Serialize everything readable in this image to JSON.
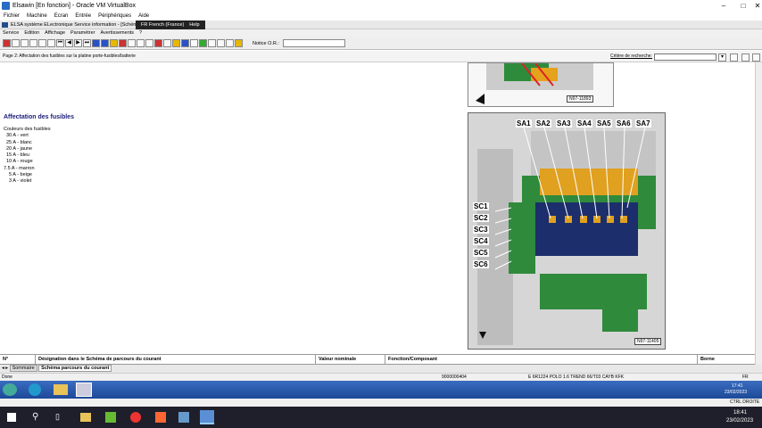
{
  "window": {
    "title": "Elsawin [En fonction] - Oracle VM VirtualBox"
  },
  "vbox_menu": [
    "Fichier",
    "Machine",
    "Ecran",
    "Entrée",
    "Périphériques",
    "Aide"
  ],
  "guest": {
    "title": "ELSA système ELectronique Service information - [Schéma",
    "lang_popup": {
      "lang": "FR French (France)",
      "help": "Help"
    }
  },
  "app_menu": [
    "Service",
    "Edition",
    "Affichage",
    "Paramétrer",
    "Avertissements",
    "?"
  ],
  "toolbar": {
    "notice_label": "Notice O.R.:"
  },
  "page_bar": {
    "title": "Page 2: Affectation des fusibles sur la platine porte-fusibles/batterie",
    "criteria_label": "Critère de recherche:"
  },
  "doc": {
    "heading": "Affectation des fusibles",
    "fuse_colors": [
      "Couleurs des fusibles",
      "30 A - vert",
      "25 A - blanc",
      "20 A - jaune",
      "15 A - bleu",
      "10 A - rouge",
      "7.5 A - marron",
      "5 A - beige",
      "3 A - violet"
    ]
  },
  "figure_top": {
    "ref": "N97-11893"
  },
  "figure_main": {
    "ref": "N97-11405",
    "top_labels": [
      "SA1",
      "SA2",
      "SA3",
      "SA4",
      "SA5",
      "SA6",
      "SA7"
    ],
    "side_labels": [
      "SC1",
      "SC2",
      "SC3",
      "SC4",
      "SC5",
      "SC6"
    ]
  },
  "table": {
    "headers": [
      "N°",
      "Désignation dans le Schéma de parcours du courant",
      "Valeur nominale",
      "Fonction/Composant",
      "Borne"
    ]
  },
  "tabs": {
    "summary": "Sommaire",
    "schema": "Schéma parcours du courant"
  },
  "status": {
    "left": "Done",
    "code": "9000000404",
    "vehicle": "E 6R1224  POLO 1.6 TREND 66/T03  CAYB  KFK",
    "lang": "FR"
  },
  "guest_clock": {
    "time": "17:41",
    "date": "23/02/2023"
  },
  "vbox_status": {
    "ctrl": "CTRL DROITE"
  },
  "host_clock": {
    "time": "18:41",
    "date": "23/02/2023"
  }
}
